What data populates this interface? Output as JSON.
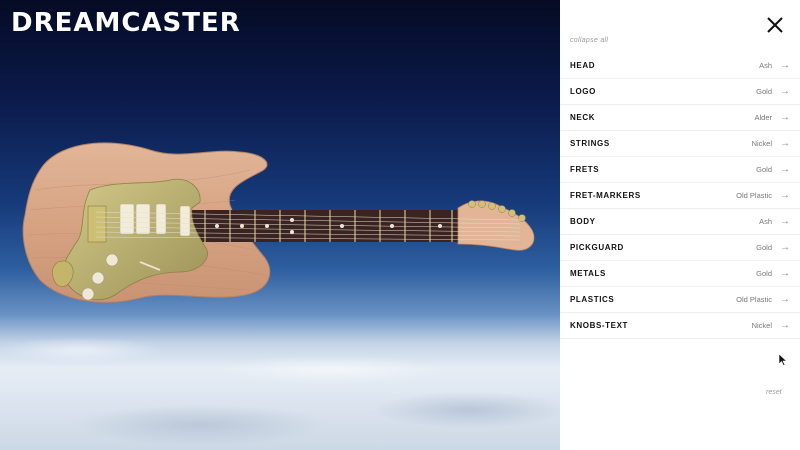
{
  "app": {
    "brand": "DREAMCASTER"
  },
  "panel": {
    "collapse_label": "collapse all",
    "reset_label": "reset",
    "options": [
      {
        "label": "HEAD",
        "value": "Ash"
      },
      {
        "label": "LOGO",
        "value": "Gold"
      },
      {
        "label": "NECK",
        "value": "Alder"
      },
      {
        "label": "STRINGS",
        "value": "Nickel"
      },
      {
        "label": "FRETS",
        "value": "Gold"
      },
      {
        "label": "FRET-MARKERS",
        "value": "Old Plastic"
      },
      {
        "label": "BODY",
        "value": "Ash"
      },
      {
        "label": "PICKGUARD",
        "value": "Gold"
      },
      {
        "label": "METALS",
        "value": "Gold"
      },
      {
        "label": "PLASTICS",
        "value": "Old Plastic"
      },
      {
        "label": "KNOBS-TEXT",
        "value": "Nickel"
      }
    ]
  },
  "icons": {
    "close": "close-icon",
    "arrow": "arrow-right-icon"
  },
  "colors": {
    "body_wood": "#d9a98b",
    "pickguard": "#b7ae6d",
    "fretboard": "#3a2320",
    "neck_wood": "#e1b596"
  }
}
